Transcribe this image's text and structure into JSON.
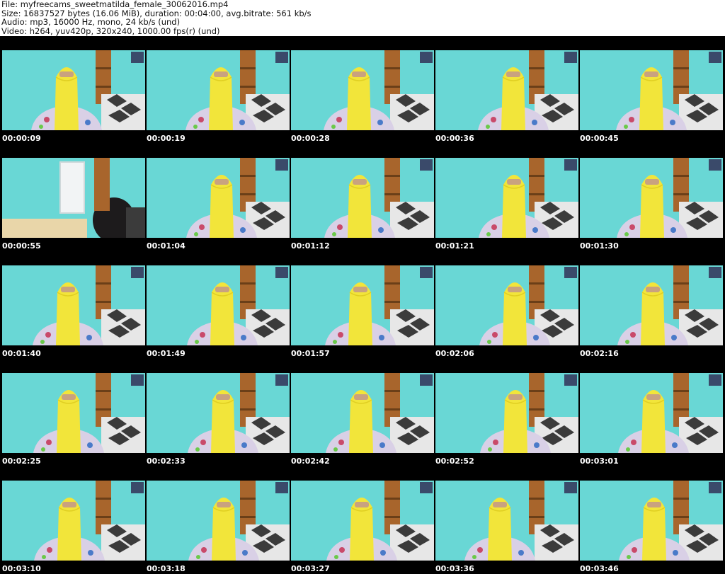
{
  "header": {
    "file_line": "File: myfreecams_sweetmatilda_female_30062016.mp4",
    "size_line": "Size: 16837527 bytes (16.06 MiB), duration: 00:04:00, avg.bitrate: 561 kb/s",
    "audio_line": "Audio: mp3, 16000 Hz, mono, 24 kb/s (und)",
    "video_line": "Video: h264, yuv420p, 320x240, 1000.00 fps(r) (und)"
  },
  "colors": {
    "wall": "#5fd2cf",
    "veil": "#f2e53a",
    "shirt": "#d9d0e6",
    "shelf": "#a8652c",
    "sofa": "#3b3b3b",
    "background": "#000000"
  },
  "thumbnails": [
    {
      "timestamp": "00:00:09"
    },
    {
      "timestamp": "00:00:19"
    },
    {
      "timestamp": "00:00:28"
    },
    {
      "timestamp": "00:00:36"
    },
    {
      "timestamp": "00:00:45"
    },
    {
      "timestamp": "00:00:55"
    },
    {
      "timestamp": "00:01:04"
    },
    {
      "timestamp": "00:01:12"
    },
    {
      "timestamp": "00:01:21"
    },
    {
      "timestamp": "00:01:30"
    },
    {
      "timestamp": "00:01:40"
    },
    {
      "timestamp": "00:01:49"
    },
    {
      "timestamp": "00:01:57"
    },
    {
      "timestamp": "00:02:06"
    },
    {
      "timestamp": "00:02:16"
    },
    {
      "timestamp": "00:02:25"
    },
    {
      "timestamp": "00:02:33"
    },
    {
      "timestamp": "00:02:42"
    },
    {
      "timestamp": "00:02:52"
    },
    {
      "timestamp": "00:03:01"
    },
    {
      "timestamp": "00:03:10"
    },
    {
      "timestamp": "00:03:18"
    },
    {
      "timestamp": "00:03:27"
    },
    {
      "timestamp": "00:03:36"
    },
    {
      "timestamp": "00:03:46"
    }
  ]
}
